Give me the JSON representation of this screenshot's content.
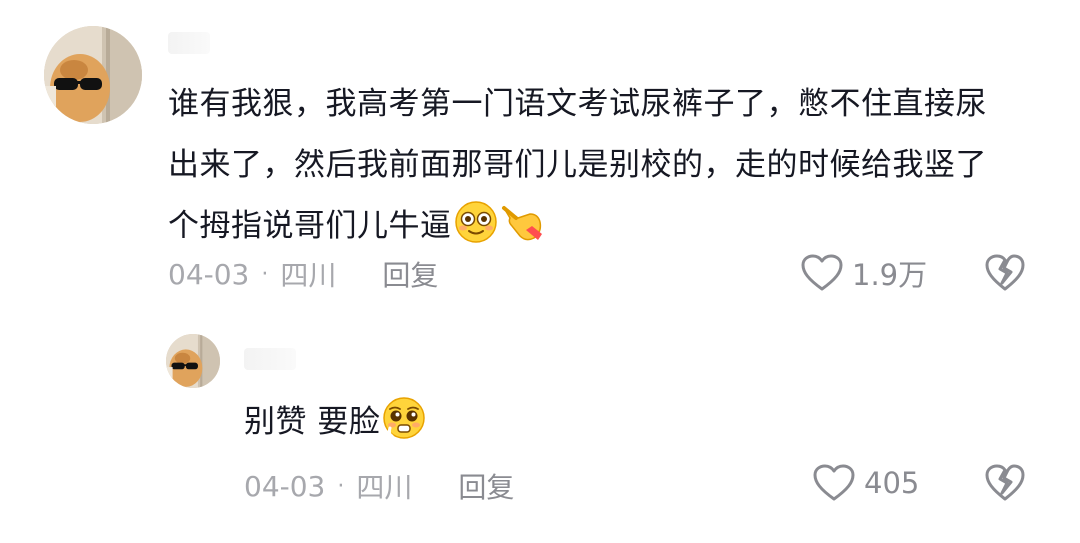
{
  "comments": [
    {
      "text": "谁有我狠，我高考第一门语文考试尿裤子了，憋不住直接尿出来了，然后我前面那哥们儿是别校的，走的时候给我竖了个拇指说哥们儿牛逼",
      "emojis": [
        "flushed-face-icon",
        "pointing-hand-icon"
      ],
      "date": "04-03",
      "location": "四川",
      "reply_label": "回复",
      "likes": "1.9万"
    },
    {
      "text": "别赞 要脸",
      "emojis": [
        "pleading-face-icon"
      ],
      "date": "04-03",
      "location": "四川",
      "reply_label": "回复",
      "likes": "405"
    }
  ],
  "meta_separator": "·",
  "colors": {
    "text": "#161823",
    "meta": "#a7a8ad",
    "icon": "#8a8b91"
  }
}
